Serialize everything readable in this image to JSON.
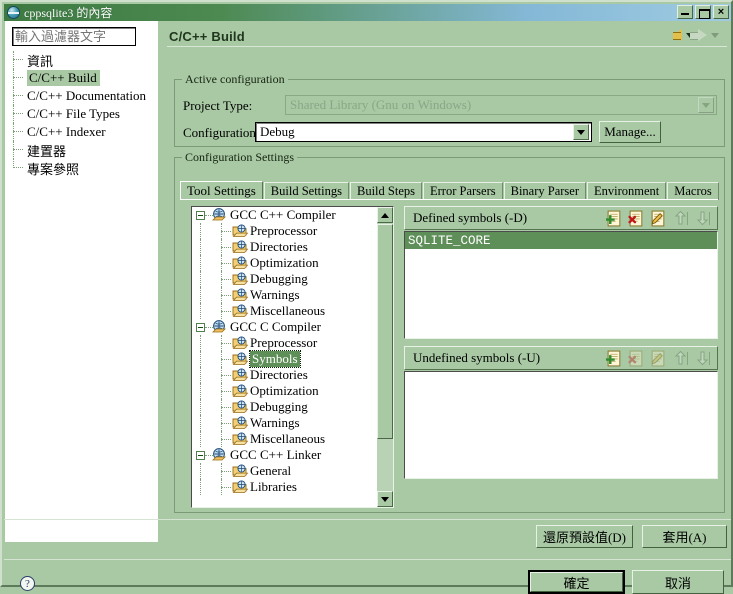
{
  "window": {
    "title": "cppsqlite3 的內容",
    "icon": "globe-icon",
    "minimize_label": "",
    "maximize_label": "",
    "close_label": "×"
  },
  "colors": {
    "window_bg": "#a8c9a4",
    "title_gradient_start": "#3c7a42",
    "title_gradient_end": "#9fcbe2",
    "selection_green": "#5f8f59",
    "selection_pale": "#a8c9a4",
    "accent_yellow": "#e3c04c"
  },
  "left_tree": {
    "filter_placeholder": "輸入過濾器文字",
    "filter_value": "",
    "items": [
      {
        "label": "資訊",
        "selected": false
      },
      {
        "label": "C/C++ Build",
        "selected": true
      },
      {
        "label": "C/C++ Documentation",
        "selected": false
      },
      {
        "label": "C/C++ File Types",
        "selected": false
      },
      {
        "label": "C/C++ Indexer",
        "selected": false
      },
      {
        "label": "建置器",
        "selected": false
      },
      {
        "label": "專案參照",
        "selected": false
      }
    ]
  },
  "page": {
    "title": "C/C++ Build",
    "nav": {
      "back_icon": "back-arrow-icon",
      "back_menu_icon": "chevron-down-icon",
      "forward_icon": "forward-arrow-icon",
      "forward_menu_icon": "chevron-down-icon"
    }
  },
  "active_configuration": {
    "group_label": "Active configuration",
    "project_type_label": "Project Type:",
    "project_type_value": "Shared Library (Gnu on Windows)",
    "configuration_label": "Configuration:",
    "configuration_value": "Debug",
    "manage_label": "Manage..."
  },
  "configuration_settings": {
    "group_label": "Configuration Settings",
    "tabs": [
      {
        "label": "Tool Settings",
        "active": true
      },
      {
        "label": "Build Settings",
        "active": false
      },
      {
        "label": "Build Steps",
        "active": false
      },
      {
        "label": "Error Parsers",
        "active": false
      },
      {
        "label": "Binary Parser",
        "active": false
      },
      {
        "label": "Environment",
        "active": false
      },
      {
        "label": "Macros",
        "active": false
      }
    ],
    "tool_tree": [
      {
        "label": "GCC C++ Compiler",
        "level": 0,
        "icon": "tool-icon",
        "expanded": true,
        "selected": false
      },
      {
        "label": "Preprocessor",
        "level": 1,
        "icon": "folder-icon",
        "selected": false
      },
      {
        "label": "Directories",
        "level": 1,
        "icon": "folder-icon",
        "selected": false
      },
      {
        "label": "Optimization",
        "level": 1,
        "icon": "folder-icon",
        "selected": false
      },
      {
        "label": "Debugging",
        "level": 1,
        "icon": "folder-icon",
        "selected": false
      },
      {
        "label": "Warnings",
        "level": 1,
        "icon": "folder-icon",
        "selected": false
      },
      {
        "label": "Miscellaneous",
        "level": 1,
        "icon": "folder-icon",
        "selected": false
      },
      {
        "label": "GCC C Compiler",
        "level": 0,
        "icon": "tool-icon",
        "expanded": true,
        "selected": false
      },
      {
        "label": "Preprocessor",
        "level": 1,
        "icon": "folder-icon",
        "selected": false
      },
      {
        "label": "Symbols",
        "level": 1,
        "icon": "folder-icon",
        "selected": true
      },
      {
        "label": "Directories",
        "level": 1,
        "icon": "folder-icon",
        "selected": false
      },
      {
        "label": "Optimization",
        "level": 1,
        "icon": "folder-icon",
        "selected": false
      },
      {
        "label": "Debugging",
        "level": 1,
        "icon": "folder-icon",
        "selected": false
      },
      {
        "label": "Warnings",
        "level": 1,
        "icon": "folder-icon",
        "selected": false
      },
      {
        "label": "Miscellaneous",
        "level": 1,
        "icon": "folder-icon",
        "selected": false
      },
      {
        "label": "GCC C++ Linker",
        "level": 0,
        "icon": "tool-icon",
        "expanded": true,
        "selected": false
      },
      {
        "label": "General",
        "level": 1,
        "icon": "folder-icon",
        "selected": false
      },
      {
        "label": "Libraries",
        "level": 1,
        "icon": "folder-icon",
        "selected": false
      }
    ],
    "defined_symbols": {
      "title": "Defined symbols (-D)",
      "tools": [
        {
          "name": "add-symbol-icon",
          "enabled": true
        },
        {
          "name": "delete-symbol-icon",
          "enabled": true
        },
        {
          "name": "edit-symbol-icon",
          "enabled": true
        },
        {
          "name": "move-up-icon",
          "enabled": false
        },
        {
          "name": "move-down-icon",
          "enabled": false
        }
      ],
      "items": [
        "SQLITE_CORE"
      ],
      "selected_item": "SQLITE_CORE"
    },
    "undefined_symbols": {
      "title": "Undefined symbols (-U)",
      "tools": [
        {
          "name": "add-symbol-icon",
          "enabled": true
        },
        {
          "name": "delete-symbol-icon",
          "enabled": false
        },
        {
          "name": "edit-symbol-icon",
          "enabled": false
        },
        {
          "name": "move-up-icon",
          "enabled": false
        },
        {
          "name": "move-down-icon",
          "enabled": false
        }
      ],
      "items": []
    },
    "restore_defaults_label": "還原預設值(D)",
    "apply_label": "套用(A)"
  },
  "footer": {
    "help_icon": "help-icon",
    "help_glyph": "?",
    "ok_label": "確定",
    "cancel_label": "取消"
  }
}
